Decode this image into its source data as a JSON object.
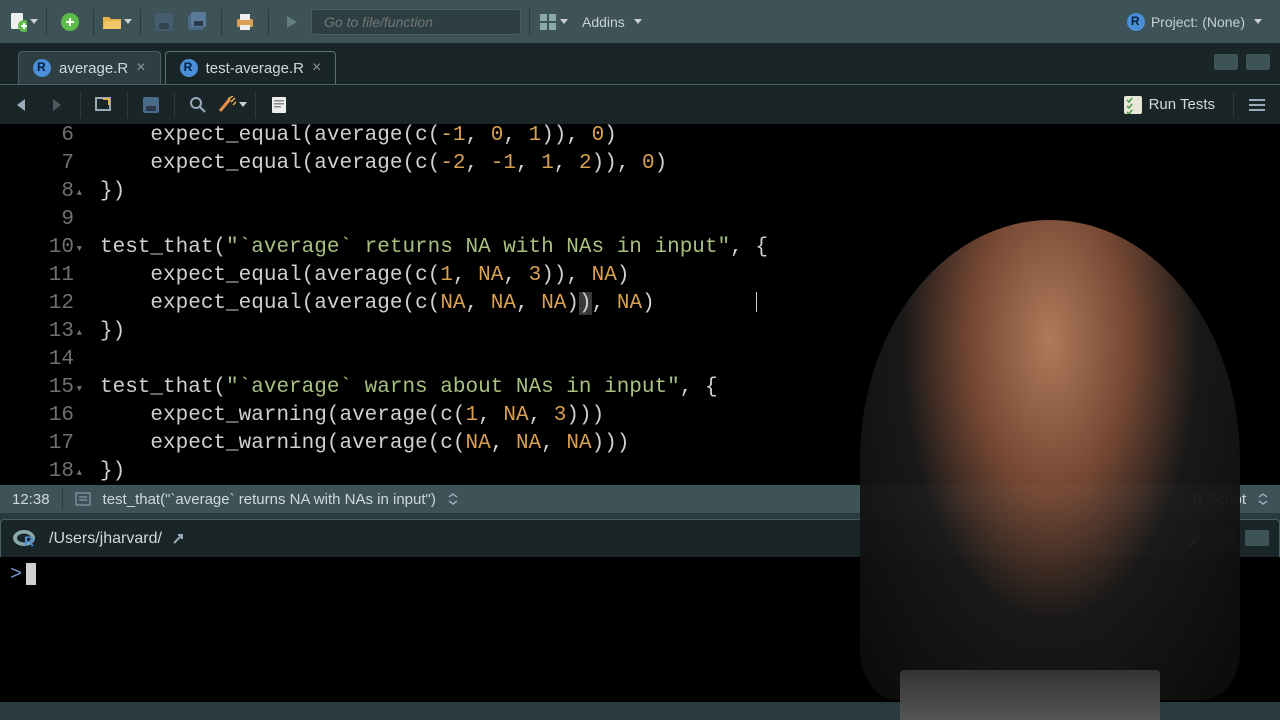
{
  "toolbar": {
    "goto_placeholder": "Go to file/function",
    "addins_label": "Addins",
    "project_label": "Project: (None)"
  },
  "tabs": [
    {
      "label": "average.R",
      "active": false
    },
    {
      "label": "test-average.R",
      "active": true
    }
  ],
  "subtoolbar": {
    "run_tests": "Run Tests"
  },
  "editor_lines": [
    {
      "n": 6,
      "indent": 2,
      "tokens": [
        {
          "t": "fn",
          "v": "expect_equal"
        },
        {
          "t": "punc",
          "v": "("
        },
        {
          "t": "fn",
          "v": "average"
        },
        {
          "t": "punc",
          "v": "("
        },
        {
          "t": "fn",
          "v": "c"
        },
        {
          "t": "punc",
          "v": "("
        },
        {
          "t": "num",
          "v": "-1"
        },
        {
          "t": "punc",
          "v": ", "
        },
        {
          "t": "num",
          "v": "0"
        },
        {
          "t": "punc",
          "v": ", "
        },
        {
          "t": "num",
          "v": "1"
        },
        {
          "t": "punc",
          "v": ")), "
        },
        {
          "t": "num",
          "v": "0"
        },
        {
          "t": "punc",
          "v": ")"
        }
      ]
    },
    {
      "n": 7,
      "indent": 2,
      "tokens": [
        {
          "t": "fn",
          "v": "expect_equal"
        },
        {
          "t": "punc",
          "v": "("
        },
        {
          "t": "fn",
          "v": "average"
        },
        {
          "t": "punc",
          "v": "("
        },
        {
          "t": "fn",
          "v": "c"
        },
        {
          "t": "punc",
          "v": "("
        },
        {
          "t": "num",
          "v": "-2"
        },
        {
          "t": "punc",
          "v": ", "
        },
        {
          "t": "num",
          "v": "-1"
        },
        {
          "t": "punc",
          "v": ", "
        },
        {
          "t": "num",
          "v": "1"
        },
        {
          "t": "punc",
          "v": ", "
        },
        {
          "t": "num",
          "v": "2"
        },
        {
          "t": "punc",
          "v": ")), "
        },
        {
          "t": "num",
          "v": "0"
        },
        {
          "t": "punc",
          "v": ")"
        }
      ]
    },
    {
      "n": 8,
      "fold": "up",
      "indent": 0,
      "tokens": [
        {
          "t": "brace",
          "v": "})"
        }
      ]
    },
    {
      "n": 9,
      "indent": 0,
      "tokens": []
    },
    {
      "n": 10,
      "fold": "down",
      "indent": 0,
      "tokens": [
        {
          "t": "fn",
          "v": "test_that"
        },
        {
          "t": "punc",
          "v": "("
        },
        {
          "t": "str",
          "v": "\"`average` returns NA with NAs in input\""
        },
        {
          "t": "punc",
          "v": ", "
        },
        {
          "t": "brace",
          "v": "{"
        }
      ]
    },
    {
      "n": 11,
      "indent": 2,
      "tokens": [
        {
          "t": "fn",
          "v": "expect_equal"
        },
        {
          "t": "punc",
          "v": "("
        },
        {
          "t": "fn",
          "v": "average"
        },
        {
          "t": "punc",
          "v": "("
        },
        {
          "t": "fn",
          "v": "c"
        },
        {
          "t": "punc",
          "v": "("
        },
        {
          "t": "num",
          "v": "1"
        },
        {
          "t": "punc",
          "v": ", "
        },
        {
          "t": "na",
          "v": "NA"
        },
        {
          "t": "punc",
          "v": ", "
        },
        {
          "t": "num",
          "v": "3"
        },
        {
          "t": "punc",
          "v": ")), "
        },
        {
          "t": "na",
          "v": "NA"
        },
        {
          "t": "punc",
          "v": ")"
        }
      ]
    },
    {
      "n": 12,
      "indent": 2,
      "tokens": [
        {
          "t": "fn",
          "v": "expect_equal"
        },
        {
          "t": "punc",
          "v": "("
        },
        {
          "t": "fn",
          "v": "average"
        },
        {
          "t": "punc",
          "v": "("
        },
        {
          "t": "fn",
          "v": "c"
        },
        {
          "t": "punc",
          "v": "("
        },
        {
          "t": "na",
          "v": "NA"
        },
        {
          "t": "punc",
          "v": ", "
        },
        {
          "t": "na",
          "v": "NA"
        },
        {
          "t": "punc",
          "v": ", "
        },
        {
          "t": "na",
          "v": "NA"
        },
        {
          "t": "punc",
          "v": ")"
        },
        {
          "t": "hlparen",
          "v": ")"
        },
        {
          "t": "punc",
          "v": ", "
        },
        {
          "t": "na",
          "v": "NA"
        },
        {
          "t": "punc",
          "v": ")"
        }
      ]
    },
    {
      "n": 13,
      "fold": "up",
      "indent": 0,
      "tokens": [
        {
          "t": "brace",
          "v": "})"
        }
      ]
    },
    {
      "n": 14,
      "indent": 0,
      "tokens": []
    },
    {
      "n": 15,
      "fold": "down",
      "indent": 0,
      "tokens": [
        {
          "t": "fn",
          "v": "test_that"
        },
        {
          "t": "punc",
          "v": "("
        },
        {
          "t": "str",
          "v": "\"`average` warns about NAs in input\""
        },
        {
          "t": "punc",
          "v": ", "
        },
        {
          "t": "brace",
          "v": "{"
        }
      ]
    },
    {
      "n": 16,
      "indent": 2,
      "tokens": [
        {
          "t": "fn",
          "v": "expect_warning"
        },
        {
          "t": "punc",
          "v": "("
        },
        {
          "t": "fn",
          "v": "average"
        },
        {
          "t": "punc",
          "v": "("
        },
        {
          "t": "fn",
          "v": "c"
        },
        {
          "t": "punc",
          "v": "("
        },
        {
          "t": "num",
          "v": "1"
        },
        {
          "t": "punc",
          "v": ", "
        },
        {
          "t": "na",
          "v": "NA"
        },
        {
          "t": "punc",
          "v": ", "
        },
        {
          "t": "num",
          "v": "3"
        },
        {
          "t": "punc",
          "v": ")))"
        }
      ]
    },
    {
      "n": 17,
      "indent": 2,
      "tokens": [
        {
          "t": "fn",
          "v": "expect_warning"
        },
        {
          "t": "punc",
          "v": "("
        },
        {
          "t": "fn",
          "v": "average"
        },
        {
          "t": "punc",
          "v": "("
        },
        {
          "t": "fn",
          "v": "c"
        },
        {
          "t": "punc",
          "v": "("
        },
        {
          "t": "na",
          "v": "NA"
        },
        {
          "t": "punc",
          "v": ", "
        },
        {
          "t": "na",
          "v": "NA"
        },
        {
          "t": "punc",
          "v": ", "
        },
        {
          "t": "na",
          "v": "NA"
        },
        {
          "t": "punc",
          "v": ")))"
        }
      ]
    },
    {
      "n": 18,
      "fold": "up",
      "indent": 0,
      "tokens": [
        {
          "t": "brace",
          "v": "})"
        }
      ]
    }
  ],
  "status": {
    "pos": "12:38",
    "scope": "test_that(\"`average` returns NA with NAs in input\")",
    "lang": "R Script"
  },
  "console": {
    "path": "/Users/jharvard/",
    "prompt": ">"
  }
}
